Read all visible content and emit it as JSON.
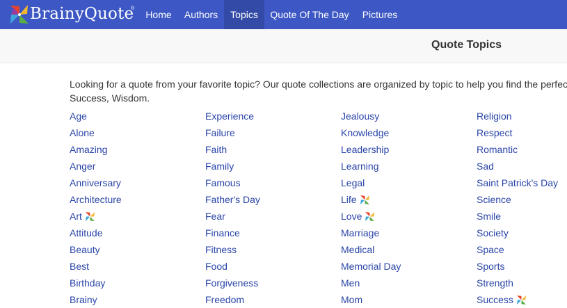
{
  "brand": {
    "name": "BrainyQuote",
    "trademark": "®",
    "colors": {
      "navbar": "#3d58c4",
      "navbar_active": "#334ba7",
      "link": "#2a45a8"
    },
    "logo_icon": "pinwheel-icon"
  },
  "nav": {
    "items": [
      {
        "label": "Home",
        "active": false
      },
      {
        "label": "Authors",
        "active": false
      },
      {
        "label": "Topics",
        "active": true
      },
      {
        "label": "Quote Of The Day",
        "active": false
      },
      {
        "label": "Pictures",
        "active": false
      }
    ]
  },
  "page": {
    "title": "Quote Topics",
    "intro_line1": "Looking for a quote from your favorite topic? Our quote collections are organized by topic to help you find the perfect",
    "intro_line2": "Success, Wisdom."
  },
  "topics": {
    "columns": [
      [
        {
          "label": "Age"
        },
        {
          "label": "Alone"
        },
        {
          "label": "Amazing"
        },
        {
          "label": "Anger"
        },
        {
          "label": "Anniversary"
        },
        {
          "label": "Architecture"
        },
        {
          "label": "Art",
          "picture_icon": true
        },
        {
          "label": "Attitude"
        },
        {
          "label": "Beauty"
        },
        {
          "label": "Best"
        },
        {
          "label": "Birthday"
        },
        {
          "label": "Brainy"
        }
      ],
      [
        {
          "label": "Experience"
        },
        {
          "label": "Failure"
        },
        {
          "label": "Faith"
        },
        {
          "label": "Family"
        },
        {
          "label": "Famous"
        },
        {
          "label": "Father's Day"
        },
        {
          "label": "Fear"
        },
        {
          "label": "Finance"
        },
        {
          "label": "Fitness"
        },
        {
          "label": "Food"
        },
        {
          "label": "Forgiveness"
        },
        {
          "label": "Freedom"
        }
      ],
      [
        {
          "label": "Jealousy"
        },
        {
          "label": "Knowledge"
        },
        {
          "label": "Leadership"
        },
        {
          "label": "Learning"
        },
        {
          "label": "Legal"
        },
        {
          "label": "Life",
          "picture_icon": true
        },
        {
          "label": "Love",
          "picture_icon": true
        },
        {
          "label": "Marriage"
        },
        {
          "label": "Medical"
        },
        {
          "label": "Memorial Day"
        },
        {
          "label": "Men"
        },
        {
          "label": "Mom"
        }
      ],
      [
        {
          "label": "Religion"
        },
        {
          "label": "Respect"
        },
        {
          "label": "Romantic"
        },
        {
          "label": "Sad"
        },
        {
          "label": "Saint Patrick's Day"
        },
        {
          "label": "Science"
        },
        {
          "label": "Smile"
        },
        {
          "label": "Society"
        },
        {
          "label": "Space"
        },
        {
          "label": "Sports"
        },
        {
          "label": "Strength"
        },
        {
          "label": "Success",
          "picture_icon": true
        }
      ]
    ]
  }
}
